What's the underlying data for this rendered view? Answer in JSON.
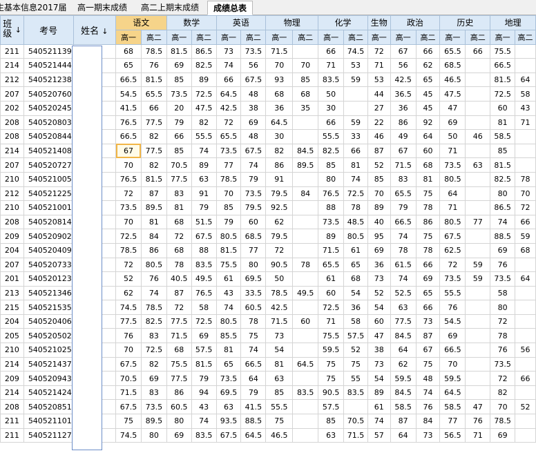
{
  "tabs": [
    {
      "label": "生基本信息2017届",
      "active": false
    },
    {
      "label": "高一期末成绩",
      "active": false
    },
    {
      "label": "高二上期末成绩",
      "active": false
    },
    {
      "label": "成绩总表",
      "active": true
    }
  ],
  "header": {
    "class_label": "班级",
    "exam_label": "考号",
    "name_label": "姓名",
    "sort_icon": "↓",
    "subjects": [
      "语文",
      "数学",
      "英语",
      "物理",
      "化学",
      "生物",
      "政治",
      "历史",
      "地理"
    ],
    "subjects_sub_count": [
      2,
      2,
      2,
      2,
      2,
      1,
      2,
      2,
      2
    ],
    "sub_labels": [
      "高一",
      "高二",
      "高一",
      "高二",
      "高一",
      "高二",
      "高一",
      "高二",
      "高一",
      "高二",
      "高一",
      "高一",
      "高二",
      "高一",
      "高二",
      "高一",
      "高二"
    ],
    "selected_subject": "语文",
    "selected_sub_index": 0
  },
  "selected_row_index": 7,
  "rows": [
    {
      "class": "211",
      "id": "540521139",
      "scores": [
        "68",
        "78.5",
        "81.5",
        "86.5",
        "73",
        "73.5",
        "71.5",
        "",
        "66",
        "74.5",
        "72",
        "67",
        "66",
        "65.5",
        "66",
        "75.5",
        ""
      ]
    },
    {
      "class": "214",
      "id": "540521444",
      "scores": [
        "65",
        "76",
        "69",
        "82.5",
        "74",
        "56",
        "70",
        "70",
        "71",
        "53",
        "71",
        "56",
        "62",
        "68.5",
        "",
        "66.5",
        ""
      ]
    },
    {
      "class": "212",
      "id": "540521238",
      "scores": [
        "66.5",
        "81.5",
        "85",
        "89",
        "66",
        "67.5",
        "93",
        "85",
        "83.5",
        "59",
        "53",
        "42.5",
        "65",
        "46.5",
        "",
        "81.5",
        "64"
      ]
    },
    {
      "class": "207",
      "id": "540520760",
      "scores": [
        "54.5",
        "65.5",
        "73.5",
        "72.5",
        "64.5",
        "48",
        "68",
        "68",
        "50",
        "",
        "44",
        "36.5",
        "45",
        "47.5",
        "",
        "72.5",
        "58"
      ]
    },
    {
      "class": "202",
      "id": "540520245",
      "scores": [
        "41.5",
        "66",
        "20",
        "47.5",
        "42.5",
        "38",
        "36",
        "35",
        "30",
        "",
        "27",
        "36",
        "45",
        "47",
        "",
        "60",
        "43"
      ]
    },
    {
      "class": "208",
      "id": "540520803",
      "scores": [
        "76.5",
        "77.5",
        "79",
        "82",
        "72",
        "69",
        "64.5",
        "",
        "66",
        "59",
        "22",
        "86",
        "92",
        "69",
        "",
        "81",
        "71"
      ]
    },
    {
      "class": "208",
      "id": "540520844",
      "scores": [
        "66.5",
        "82",
        "66",
        "55.5",
        "65.5",
        "48",
        "30",
        "",
        "55.5",
        "33",
        "46",
        "49",
        "64",
        "50",
        "46",
        "58.5",
        ""
      ]
    },
    {
      "class": "214",
      "id": "540521408",
      "scores": [
        "67",
        "77.5",
        "85",
        "74",
        "73.5",
        "67.5",
        "82",
        "84.5",
        "82.5",
        "66",
        "87",
        "67",
        "60",
        "71",
        "",
        "85",
        ""
      ]
    },
    {
      "class": "207",
      "id": "540520727",
      "scores": [
        "70",
        "82",
        "70.5",
        "89",
        "77",
        "74",
        "86",
        "89.5",
        "85",
        "81",
        "52",
        "71.5",
        "68",
        "73.5",
        "63",
        "81.5",
        ""
      ]
    },
    {
      "class": "210",
      "id": "540521005",
      "scores": [
        "76.5",
        "81.5",
        "77.5",
        "63",
        "78.5",
        "79",
        "91",
        "",
        "80",
        "74",
        "85",
        "83",
        "81",
        "80.5",
        "",
        "82.5",
        "78"
      ]
    },
    {
      "class": "212",
      "id": "540521225",
      "scores": [
        "72",
        "87",
        "83",
        "91",
        "70",
        "73.5",
        "79.5",
        "84",
        "76.5",
        "72.5",
        "70",
        "65.5",
        "75",
        "64",
        "",
        "80",
        "70"
      ]
    },
    {
      "class": "210",
      "id": "540521001",
      "scores": [
        "73.5",
        "89.5",
        "81",
        "79",
        "85",
        "79.5",
        "92.5",
        "",
        "88",
        "78",
        "89",
        "79",
        "78",
        "71",
        "",
        "86.5",
        "72"
      ]
    },
    {
      "class": "208",
      "id": "540520814",
      "scores": [
        "70",
        "81",
        "68",
        "51.5",
        "79",
        "60",
        "62",
        "",
        "73.5",
        "48.5",
        "40",
        "66.5",
        "86",
        "80.5",
        "77",
        "74",
        "66"
      ]
    },
    {
      "class": "209",
      "id": "540520902",
      "scores": [
        "72.5",
        "84",
        "72",
        "67.5",
        "80.5",
        "68.5",
        "79.5",
        "",
        "89",
        "80.5",
        "95",
        "74",
        "75",
        "67.5",
        "",
        "88.5",
        "59"
      ]
    },
    {
      "class": "204",
      "id": "540520409",
      "scores": [
        "78.5",
        "86",
        "68",
        "88",
        "81.5",
        "77",
        "72",
        "",
        "71.5",
        "61",
        "69",
        "78",
        "78",
        "62.5",
        "",
        "69",
        "68"
      ]
    },
    {
      "class": "207",
      "id": "540520733",
      "scores": [
        "72",
        "80.5",
        "78",
        "83.5",
        "75.5",
        "80",
        "90.5",
        "78",
        "65.5",
        "65",
        "36",
        "61.5",
        "66",
        "72",
        "59",
        "76",
        ""
      ]
    },
    {
      "class": "201",
      "id": "540520123",
      "scores": [
        "52",
        "76",
        "40.5",
        "49.5",
        "61",
        "69.5",
        "50",
        "",
        "61",
        "68",
        "73",
        "74",
        "69",
        "73.5",
        "59",
        "73.5",
        "64"
      ]
    },
    {
      "class": "213",
      "id": "540521346",
      "scores": [
        "62",
        "74",
        "87",
        "76.5",
        "43",
        "33.5",
        "78.5",
        "49.5",
        "60",
        "54",
        "52",
        "52.5",
        "65",
        "55.5",
        "",
        "58",
        ""
      ]
    },
    {
      "class": "215",
      "id": "540521535",
      "scores": [
        "74.5",
        "78.5",
        "72",
        "58",
        "74",
        "60.5",
        "42.5",
        "",
        "72.5",
        "36",
        "54",
        "63",
        "66",
        "76",
        "",
        "80",
        ""
      ]
    },
    {
      "class": "204",
      "id": "540520406",
      "scores": [
        "77.5",
        "82.5",
        "77.5",
        "72.5",
        "80.5",
        "78",
        "71.5",
        "60",
        "71",
        "58",
        "60",
        "77.5",
        "73",
        "54.5",
        "",
        "72",
        ""
      ]
    },
    {
      "class": "205",
      "id": "540520502",
      "scores": [
        "76",
        "83",
        "71.5",
        "69",
        "85.5",
        "75",
        "73",
        "",
        "75.5",
        "57.5",
        "47",
        "84.5",
        "87",
        "69",
        "",
        "78",
        ""
      ]
    },
    {
      "class": "210",
      "id": "540521025",
      "scores": [
        "70",
        "72.5",
        "68",
        "57.5",
        "81",
        "74",
        "54",
        "",
        "59.5",
        "52",
        "38",
        "64",
        "67",
        "66.5",
        "",
        "76",
        "56"
      ]
    },
    {
      "class": "214",
      "id": "540521437",
      "scores": [
        "67.5",
        "82",
        "75.5",
        "81.5",
        "65",
        "66.5",
        "81",
        "64.5",
        "75",
        "75",
        "73",
        "62",
        "75",
        "70",
        "",
        "73.5",
        ""
      ]
    },
    {
      "class": "209",
      "id": "540520943",
      "scores": [
        "70.5",
        "69",
        "77.5",
        "79",
        "73.5",
        "64",
        "63",
        "",
        "75",
        "55",
        "54",
        "59.5",
        "48",
        "59.5",
        "",
        "72",
        "66"
      ]
    },
    {
      "class": "214",
      "id": "540521424",
      "scores": [
        "71.5",
        "83",
        "86",
        "94",
        "69.5",
        "79",
        "85",
        "83.5",
        "90.5",
        "83.5",
        "89",
        "84.5",
        "74",
        "64.5",
        "",
        "82",
        ""
      ]
    },
    {
      "class": "208",
      "id": "540520851",
      "scores": [
        "67.5",
        "73.5",
        "60.5",
        "43",
        "63",
        "41.5",
        "55.5",
        "",
        "57.5",
        "",
        "61",
        "58.5",
        "76",
        "58.5",
        "47",
        "70",
        "52"
      ]
    },
    {
      "class": "211",
      "id": "540521101",
      "scores": [
        "75",
        "89.5",
        "80",
        "74",
        "93.5",
        "88.5",
        "75",
        "",
        "85",
        "70.5",
        "74",
        "87",
        "84",
        "77",
        "76",
        "78.5",
        ""
      ]
    },
    {
      "class": "211",
      "id": "540521127",
      "scores": [
        "74.5",
        "80",
        "69",
        "83.5",
        "67.5",
        "64.5",
        "46.5",
        "",
        "63",
        "71.5",
        "57",
        "64",
        "73",
        "56.5",
        "71",
        "69",
        ""
      ]
    }
  ]
}
